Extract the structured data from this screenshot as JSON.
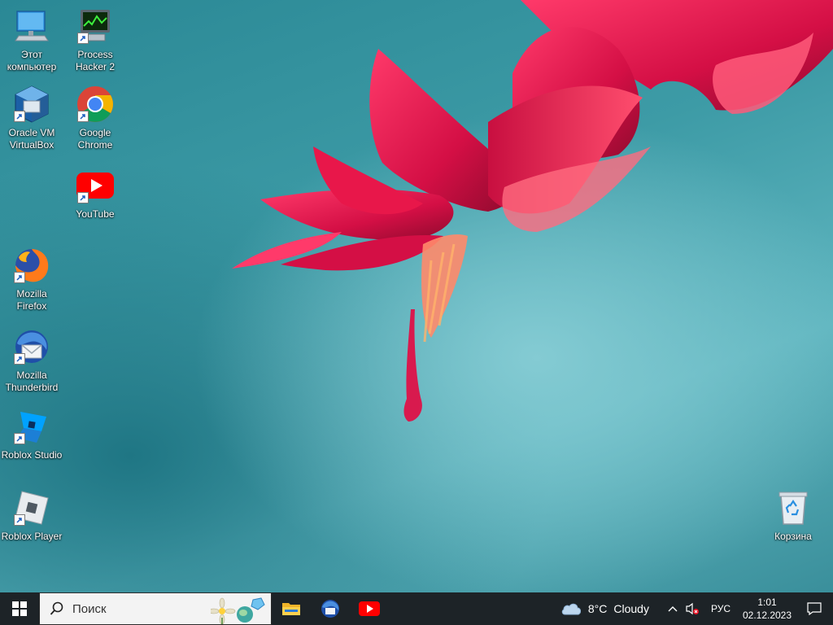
{
  "desktop": {
    "icons": [
      {
        "label_line1": "Этот",
        "label_line2": "компьютер",
        "icon": "this-pc-icon"
      },
      {
        "label_line1": "Process",
        "label_line2": "Hacker 2",
        "icon": "process-hacker-icon"
      },
      {
        "label_line1": "Oracle VM",
        "label_line2": "VirtualBox",
        "icon": "virtualbox-icon"
      },
      {
        "label_line1": "Google",
        "label_line2": "Chrome",
        "icon": "chrome-icon"
      },
      {
        "label_line1": "YouTube",
        "label_line2": "",
        "icon": "youtube-icon"
      },
      {
        "label_line1": "Mozilla",
        "label_line2": "Firefox",
        "icon": "firefox-icon"
      },
      {
        "label_line1": "Mozilla",
        "label_line2": "Thunderbird",
        "icon": "thunderbird-icon"
      },
      {
        "label_line1": "Roblox Studio",
        "label_line2": "",
        "icon": "roblox-studio-icon"
      },
      {
        "label_line1": "Roblox Player",
        "label_line2": "",
        "icon": "roblox-player-icon"
      },
      {
        "label_line1": "Корзина",
        "label_line2": "",
        "icon": "recycle-bin-icon"
      }
    ]
  },
  "taskbar": {
    "search_placeholder": "Поиск",
    "pinned": [
      "file-explorer-icon",
      "thunderbird-icon",
      "youtube-icon"
    ],
    "weather": {
      "temp": "8°C",
      "condition": "Cloudy"
    },
    "language": "РУС",
    "time": "1:01",
    "date": "02.12.2023"
  },
  "colors": {
    "taskbar_bg": "#1d2327",
    "wallpaper_teal": "#3d9ba6",
    "flower_red": "#e8174a"
  }
}
